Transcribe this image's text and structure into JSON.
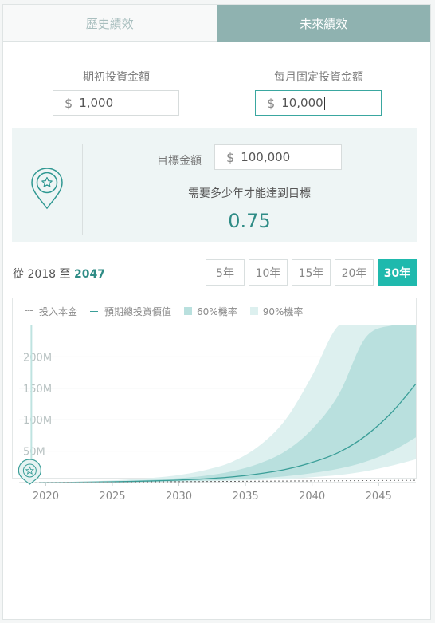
{
  "tabs": {
    "history": "歷史績效",
    "future": "未來績效"
  },
  "initial": {
    "label": "期初投資金額",
    "currency": "$",
    "value": "1,000"
  },
  "monthly": {
    "label": "每月固定投資金額",
    "currency": "$",
    "value": "10,000"
  },
  "goal": {
    "label": "目標金額",
    "currency": "$",
    "value": "100,000",
    "question": "需要多少年才能達到目標",
    "result": "0.75"
  },
  "range": {
    "prefix": "從",
    "start": "2018",
    "mid": "至",
    "end": "2047"
  },
  "year_buttons": [
    "5年",
    "10年",
    "15年",
    "20年",
    "30年"
  ],
  "active_year_button": "30年",
  "legend": {
    "principal": "投入本金",
    "expected": "預期總投資價值",
    "p60": "60%機率",
    "p90": "90%機率"
  },
  "colors": {
    "accent": "#1fb9ad",
    "tab_active": "#8fb2b0",
    "line": "#3a9e98",
    "band60": "#b9e0de",
    "band90": "#ddf0ef"
  },
  "chart_data": {
    "type": "area",
    "x_ticks": [
      2020,
      2025,
      2030,
      2035,
      2040,
      2045
    ],
    "x_tick_labels": [
      "2020",
      "2025",
      "2030",
      "2035",
      "2040",
      "2045"
    ],
    "y_ticks": [
      50,
      100,
      150,
      200
    ],
    "y_tick_labels": [
      "50M",
      "100M",
      "150M",
      "200M"
    ],
    "xlim": [
      2018,
      2047.8
    ],
    "ylim": [
      0,
      250
    ],
    "x": [
      2019.5,
      2022,
      2025,
      2028,
      2030,
      2032,
      2034,
      2036,
      2038,
      2040,
      2042,
      2044,
      2046,
      2047.8
    ],
    "series": [
      {
        "name": "預期總投資價值",
        "values": [
          0.1,
          0.5,
          1.3,
          2.6,
          4,
          6,
          9,
          14,
          21,
          32,
          48,
          74,
          112,
          157
        ]
      },
      {
        "name": "60%機率",
        "lower": [
          0.05,
          0.3,
          0.8,
          1.5,
          2.2,
          3.2,
          4.6,
          6.8,
          10,
          15,
          22,
          33,
          50,
          72
        ],
        "upper": [
          0.2,
          0.8,
          2.2,
          4.5,
          7,
          11,
          18,
          30,
          50,
          85,
          140,
          230,
          250,
          250
        ]
      },
      {
        "name": "90%機率",
        "lower": [
          0.02,
          0.2,
          0.5,
          1,
          1.4,
          2,
          2.8,
          4,
          6,
          8.5,
          12,
          18,
          27,
          37
        ],
        "upper": [
          0.3,
          1.2,
          3.5,
          7.5,
          12,
          20,
          33,
          58,
          100,
          170,
          250,
          250,
          250,
          250
        ]
      }
    ],
    "principal": {
      "x": [
        2018,
        2047.8
      ],
      "values": [
        0,
        3.6
      ]
    },
    "marker_x": 2018.8
  }
}
